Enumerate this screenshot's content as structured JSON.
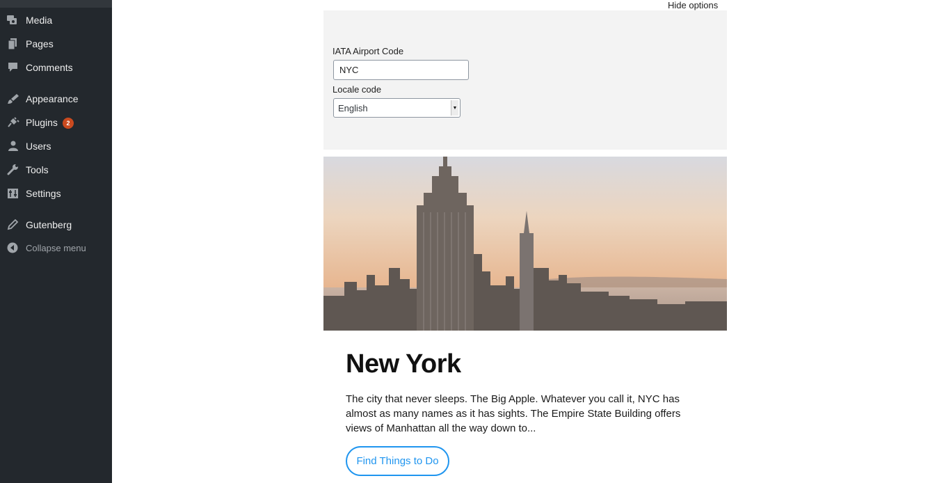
{
  "sidebar": {
    "items": [
      {
        "label": "Media",
        "icon": "media-icon"
      },
      {
        "label": "Pages",
        "icon": "pages-icon"
      },
      {
        "label": "Comments",
        "icon": "comments-icon"
      },
      {
        "label": "Appearance",
        "icon": "appearance-icon"
      },
      {
        "label": "Plugins",
        "icon": "plugins-icon",
        "badge": "2"
      },
      {
        "label": "Users",
        "icon": "users-icon"
      },
      {
        "label": "Tools",
        "icon": "tools-icon"
      },
      {
        "label": "Settings",
        "icon": "settings-icon"
      },
      {
        "label": "Gutenberg",
        "icon": "gutenberg-icon"
      },
      {
        "label": "Collapse menu",
        "icon": "collapse-icon"
      }
    ]
  },
  "options": {
    "toggle_label": "Hide options",
    "airport": {
      "label": "IATA Airport Code",
      "value": "NYC"
    },
    "locale": {
      "label": "Locale code",
      "selected": "English"
    }
  },
  "content": {
    "title": "New York",
    "description": "The city that never sleeps. The Big Apple. Whatever you call it, NYC has almost as many names as it has sights. The Empire State Building offers views of Manhattan all the way down to...",
    "cta_label": "Find Things to Do"
  },
  "colors": {
    "sidebar_bg": "#23282d",
    "badge": "#ca4a1f",
    "cta_accent": "#1f95ef",
    "panel_bg": "#f3f3f3"
  }
}
